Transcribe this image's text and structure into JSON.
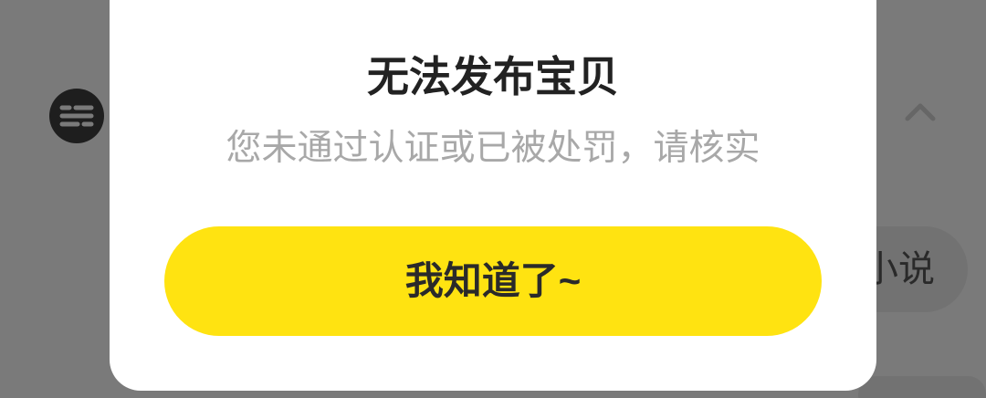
{
  "background": {
    "menu_icon": "menu-lines-icon",
    "chevron_icon": "chevron-up-icon",
    "chip_label": "小说"
  },
  "dialog": {
    "title": "无法发布宝贝",
    "message": "您未通过认证或已被处罚，请核实",
    "confirm_label": "我知道了~"
  },
  "colors": {
    "overlay": "#7a7a7a",
    "dialog_bg": "#ffffff",
    "button_bg": "#ffe311",
    "title": "#222222",
    "message": "#a8a8a8"
  }
}
